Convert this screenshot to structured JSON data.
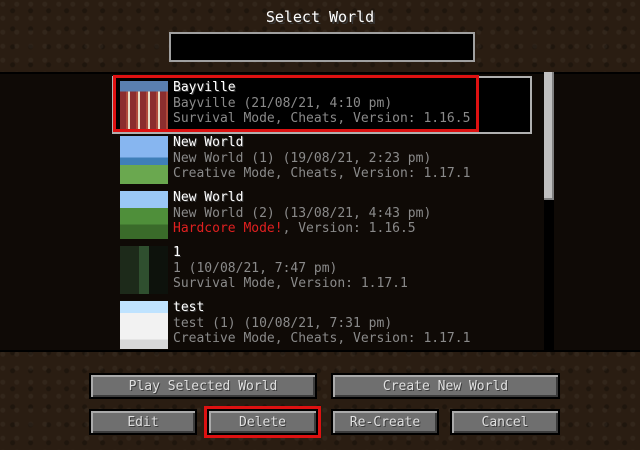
{
  "screen": {
    "title": "Select World",
    "search": {
      "value": ""
    }
  },
  "worlds": [
    {
      "name": "Bayville",
      "subtitle": "Bayville (21/08/21, 4:10 pm)",
      "mode": "Survival Mode, Cheats, Version: 1.16.5",
      "mode_prefix": "",
      "thumb": "building-thumbnail"
    },
    {
      "name": "New World",
      "subtitle": "New World (1) (19/08/21, 2:23 pm)",
      "mode": "Creative Mode, Cheats, Version: 1.17.1",
      "mode_prefix": "",
      "thumb": "ocean-thumbnail"
    },
    {
      "name": "New World",
      "subtitle": "New World (2) (13/08/21, 4:43 pm)",
      "mode": ", Version: 1.16.5",
      "mode_prefix": "Hardcore Mode!",
      "thumb": "forest-thumbnail"
    },
    {
      "name": "1",
      "subtitle": "1 (10/08/21, 7:47 pm)",
      "mode": "Survival Mode, Version: 1.17.1",
      "mode_prefix": "",
      "thumb": "dark-forest-thumbnail"
    },
    {
      "name": "test",
      "subtitle": "test (1) (10/08/21, 7:31 pm)",
      "mode": "Creative Mode, Cheats, Version: 1.17.1",
      "mode_prefix": "",
      "thumb": "snow-thumbnail"
    }
  ],
  "buttons": {
    "play": "Play Selected World",
    "create": "Create New World",
    "edit": "Edit",
    "delete": "Delete",
    "recreate": "Re-Create",
    "cancel": "Cancel"
  },
  "colors": {
    "highlight": "#dd1111",
    "hardcore": "#e02020",
    "text_gray": "#8a8a8a"
  }
}
